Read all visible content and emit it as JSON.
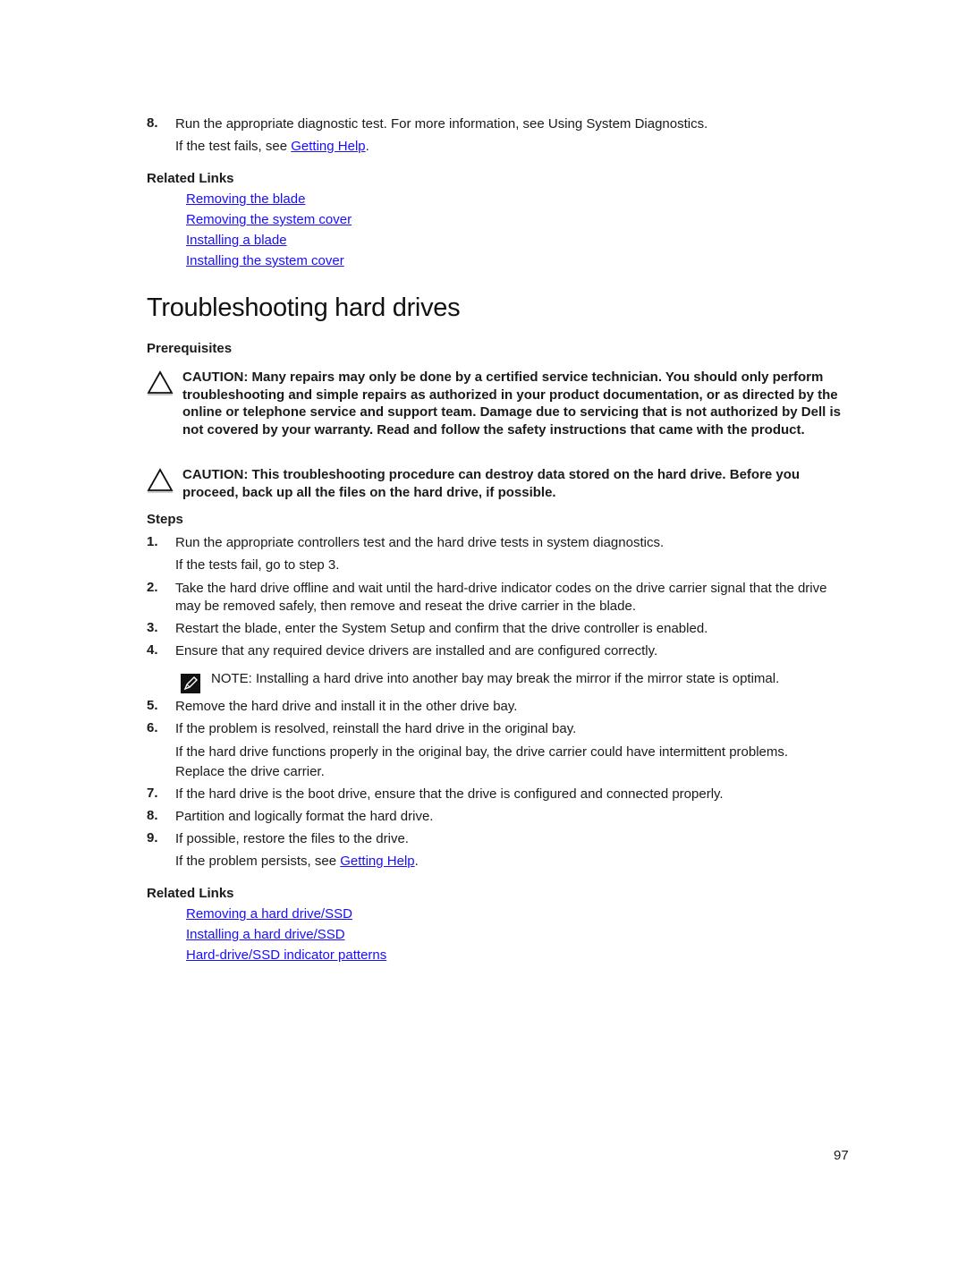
{
  "prev_section": {
    "step": {
      "number": "8.",
      "text": "Run the appropriate diagnostic test. For more information, see Using System Diagnostics."
    },
    "sub_prefix": "If the test fails, see ",
    "sub_link": "Getting Help",
    "sub_suffix": ".",
    "related_links_title": "Related Links",
    "related_links": [
      "Removing the blade",
      "Removing the system cover",
      "Installing a blade",
      "Installing the system cover"
    ]
  },
  "section": {
    "title": "Troubleshooting hard drives",
    "prerequisites_label": "Prerequisites",
    "cautions": [
      {
        "icon": "warning-triangle-icon",
        "text": "CAUTION: Many repairs may only be done by a certified service technician. You should only perform troubleshooting and simple repairs as authorized in your product documentation, or as directed by the online or telephone service and support team. Damage due to servicing that is not authorized by Dell is not covered by your warranty. Read and follow the safety instructions that came with the product."
      },
      {
        "icon": "warning-triangle-icon",
        "text": "CAUTION: This troubleshooting procedure can destroy data stored on the hard drive. Before you proceed, back up all the files on the hard drive, if possible."
      }
    ],
    "steps_label": "Steps",
    "steps": [
      {
        "number": "1.",
        "text": "Run the appropriate controllers test and the hard drive tests in system diagnostics.",
        "sub": "If the tests fail, go to step 3."
      },
      {
        "number": "2.",
        "text": "Take the hard drive offline and wait until the hard-drive indicator codes on the drive carrier signal that the drive may be removed safely, then remove and reseat the drive carrier in the blade."
      },
      {
        "number": "3.",
        "text": "Restart the blade, enter the System Setup and confirm that the drive controller is enabled."
      },
      {
        "number": "4.",
        "text": "Ensure that any required device drivers are installed and are configured correctly."
      },
      {
        "number": "5.",
        "text": "Remove the hard drive and install it in the other drive bay."
      },
      {
        "number": "6.",
        "text": "If the problem is resolved, reinstall the hard drive in the original bay.",
        "sub": "If the hard drive functions properly in the original bay, the drive carrier could have intermittent problems. Replace the drive carrier."
      },
      {
        "number": "7.",
        "text": "If the hard drive is the boot drive, ensure that the drive is configured and connected properly."
      },
      {
        "number": "8.",
        "text": "Partition and logically format the hard drive."
      },
      {
        "number": "9.",
        "text": "If possible, restore the files to the drive.",
        "sub_prefix": "If the problem persists, see ",
        "sub_link": "Getting Help",
        "sub_suffix": "."
      }
    ],
    "note": {
      "icon": "pencil-note-icon",
      "label": "NOTE:",
      "text": " Installing a hard drive into another bay may break the mirror if the mirror state is optimal."
    },
    "related_links_title": "Related Links",
    "related_links": [
      "Removing a hard drive/SSD",
      "Installing a hard drive/SSD",
      "Hard-drive/SSD indicator patterns"
    ]
  },
  "footer": {
    "page_number": "97"
  }
}
